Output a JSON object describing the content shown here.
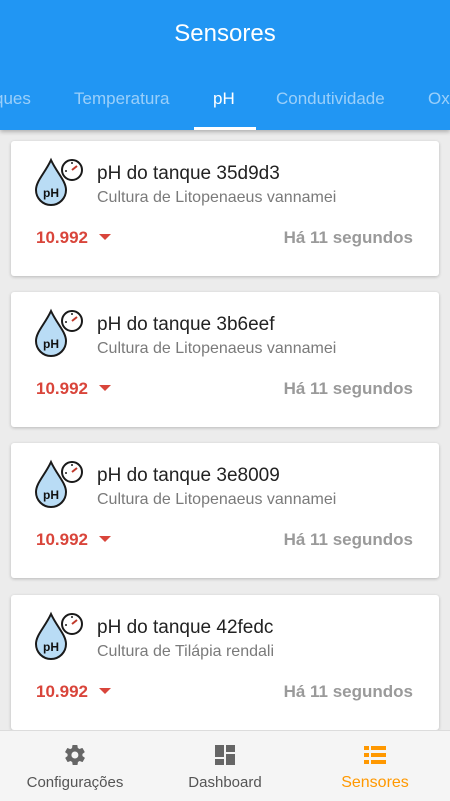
{
  "appbar": {
    "title": "Sensores"
  },
  "tabs": [
    {
      "label": "ques"
    },
    {
      "label": "Temperatura"
    },
    {
      "label": "pH"
    },
    {
      "label": "Condutividade"
    },
    {
      "label": "Ox"
    }
  ],
  "cards": [
    {
      "title": "pH do tanque 35d9d3",
      "subtitle": "Cultura de Litopenaeus vannamei",
      "value": "10.992",
      "time": "Há 11 segundos"
    },
    {
      "title": "pH do tanque 3b6eef",
      "subtitle": "Cultura de Litopenaeus vannamei",
      "value": "10.992",
      "time": "Há 11 segundos"
    },
    {
      "title": "pH do tanque 3e8009",
      "subtitle": "Cultura de Litopenaeus vannamei",
      "value": "10.992",
      "time": "Há 11 segundos"
    },
    {
      "title": "pH do tanque 42fedc",
      "subtitle": "Cultura de Tilápia rendali",
      "value": "10.992",
      "time": "Há 11 segundos"
    }
  ],
  "icon_text": "pH",
  "bottomnav": [
    {
      "label": "Configurações",
      "icon": "gear-icon"
    },
    {
      "label": "Dashboard",
      "icon": "dashboard-icon"
    },
    {
      "label": "Sensores",
      "icon": "list-icon"
    }
  ],
  "colors": {
    "primary": "#2196f3",
    "accent": "#ff9800",
    "value_down": "#d9453b",
    "icon_fill": "#b9dcf5"
  }
}
